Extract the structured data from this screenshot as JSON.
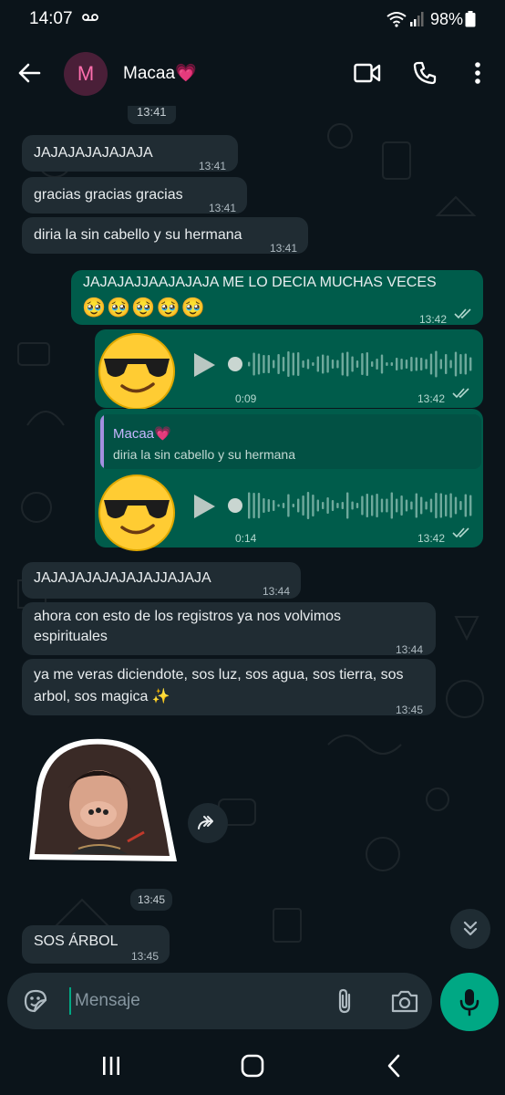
{
  "status_bar": {
    "time": "14:07",
    "battery": "98%",
    "icons": [
      "voicemail-icon",
      "wifi-icon",
      "signal-icon",
      "battery-icon"
    ]
  },
  "header": {
    "avatar_letter": "M",
    "contact_name": "Macaa💗",
    "icons": [
      "back-arrow-icon",
      "video-call-icon",
      "phone-icon",
      "more-vert-icon"
    ]
  },
  "chat": {
    "top_time": "13:41",
    "messages": [
      {
        "dir": "in",
        "text": "JAJAJAJAJAJAJA",
        "time": "13:41"
      },
      {
        "dir": "in",
        "text": "gracias gracias gracias",
        "time": "13:41"
      },
      {
        "dir": "in",
        "text": "diria la sin cabello y su hermana",
        "time": "13:41"
      },
      {
        "dir": "out",
        "text": "JAJAJAJJAAJAJAJA ME LO DECIA MUCHAS VECES",
        "emoji": "🥹🥹🥹🥹🥹",
        "time": "13:42"
      },
      {
        "dir": "out",
        "type": "voice",
        "avatar_emoji": "😎",
        "duration": "0:09",
        "time": "13:42"
      },
      {
        "dir": "out",
        "type": "voice",
        "reply_to": {
          "name": "Macaa💗",
          "text": "diria la sin cabello y su hermana"
        },
        "avatar_emoji": "😎",
        "duration": "0:14",
        "time": "13:42"
      },
      {
        "dir": "in",
        "text": "JAJAJAJAJAJAJAJJAJAJA",
        "time": "13:44"
      },
      {
        "dir": "in",
        "text": [
          "ahora con esto de los registros ya nos volvimos",
          "espirituales"
        ],
        "time": "13:44"
      },
      {
        "dir": "in",
        "text": [
          "ya me veras diciendote, sos luz, sos agua, sos tierra, sos",
          "arbol, sos magica ✨"
        ],
        "time": "13:45"
      },
      {
        "dir": "in",
        "type": "sticker",
        "time": "13:45"
      },
      {
        "dir": "in",
        "text": "SOS ÁRBOL",
        "time": "13:45"
      }
    ]
  },
  "composer": {
    "placeholder": "Mensaje",
    "icons": [
      "sticker-icon",
      "attach-icon",
      "camera-icon",
      "mic-icon"
    ]
  },
  "nav": {
    "icons": [
      "recent-apps-icon",
      "home-icon",
      "back-icon"
    ]
  },
  "colors": {
    "background": "#0b141a",
    "incoming": "#202c33",
    "outgoing": "#005c4b",
    "accent": "#00a884"
  }
}
